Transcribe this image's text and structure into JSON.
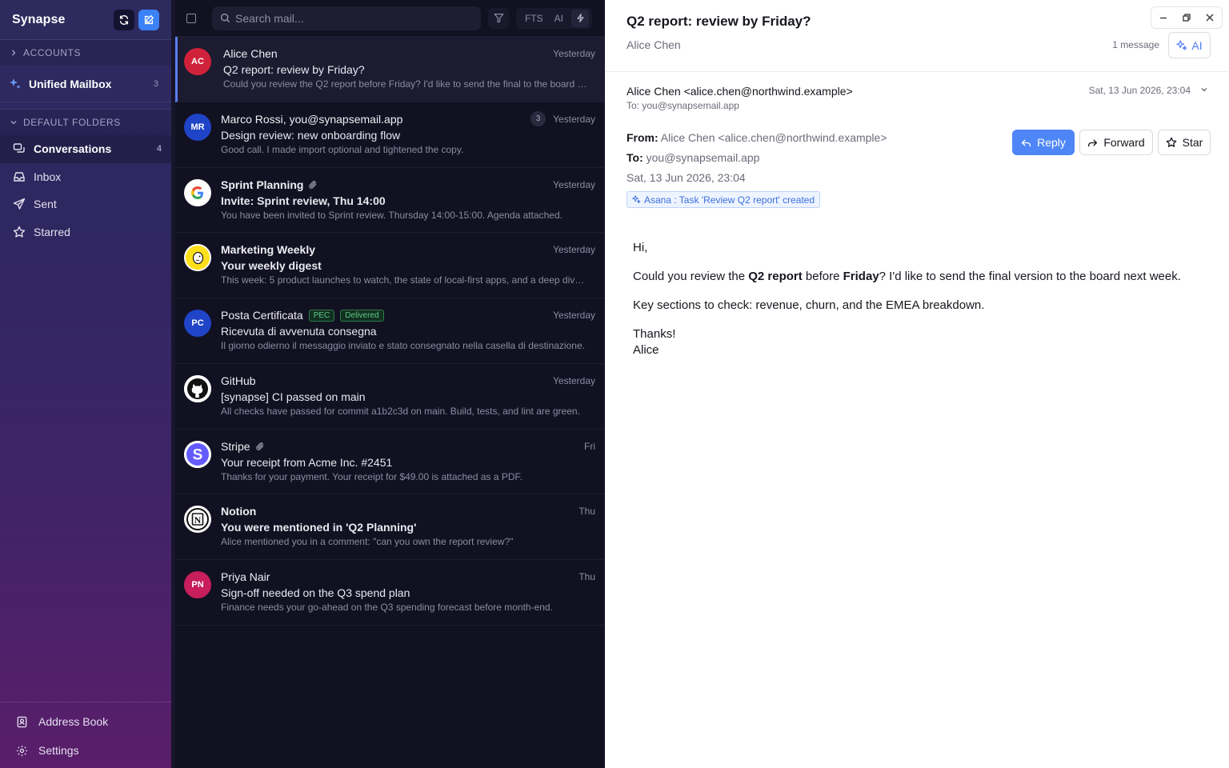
{
  "app": {
    "title": "Synapse"
  },
  "sidebar": {
    "accounts_label": "ACCOUNTS",
    "unified": {
      "label": "Unified Mailbox",
      "count": "3"
    },
    "folders_label": "DEFAULT FOLDERS",
    "folders": [
      {
        "label": "Conversations",
        "count": "4",
        "icon": "conversations-icon"
      },
      {
        "label": "Inbox",
        "count": "",
        "icon": "inbox-icon"
      },
      {
        "label": "Sent",
        "count": "",
        "icon": "send-icon"
      },
      {
        "label": "Starred",
        "count": "",
        "icon": "star-icon"
      }
    ],
    "bottom": [
      {
        "label": "Address Book",
        "icon": "address-book-icon"
      },
      {
        "label": "Settings",
        "icon": "gear-icon"
      }
    ]
  },
  "toolbar": {
    "search_placeholder": "Search mail...",
    "fts_label": "FTS",
    "ai_label": "AI"
  },
  "messages": [
    {
      "initials": "AC",
      "avatar_color": "#d0213b",
      "sender": "Alice Chen",
      "sender_bold": false,
      "time": "Yesterday",
      "subject": "Q2 report: review by Friday?",
      "subject_bold": false,
      "preview": "Could you review the Q2 report before Friday? I'd like to send the final to the board …",
      "selected": true
    },
    {
      "initials": "MR",
      "avatar_color": "#1f44c7",
      "sender": "Marco Rossi, you@synapsemail.app",
      "thread_count": "3",
      "time": "Yesterday",
      "subject": "Design review: new onboarding flow",
      "preview": "Good call. I made import optional and tightened the copy."
    },
    {
      "initials": "G",
      "avatar_type": "google",
      "sender": "Sprint Planning",
      "sender_bold": true,
      "attachment": true,
      "time": "Yesterday",
      "subject": "Invite: Sprint review, Thu 14:00",
      "subject_bold": true,
      "preview": "You have been invited to Sprint review. Thursday 14:00-15:00. Agenda attached."
    },
    {
      "initials": "",
      "avatar_type": "mailchimp",
      "sender": "Marketing Weekly",
      "sender_bold": true,
      "time": "Yesterday",
      "subject": "Your weekly digest",
      "subject_bold": true,
      "preview": "This week: 5 product launches to watch, the state of local-first apps, and a deep div…"
    },
    {
      "initials": "PC",
      "avatar_color": "#1f44c7",
      "sender": "Posta Certificata",
      "tags": [
        "PEC",
        "Delivered"
      ],
      "time": "Yesterday",
      "subject": "Ricevuta di avvenuta consegna",
      "preview": "Il giorno odierno il messaggio inviato e stato consegnato nella casella di destinazione."
    },
    {
      "initials": "",
      "avatar_type": "github",
      "sender": "GitHub",
      "time": "Yesterday",
      "subject": "[synapse] CI passed on main",
      "preview": "All checks have passed for commit a1b2c3d on main. Build, tests, and lint are green."
    },
    {
      "initials": "S",
      "avatar_type": "stripe",
      "sender": "Stripe",
      "attachment": true,
      "time": "Fri",
      "subject": "Your receipt from Acme Inc. #2451",
      "preview": "Thanks for your payment. Your receipt for $49.00 is attached as a PDF."
    },
    {
      "initials": "N",
      "avatar_type": "notion",
      "sender": "Notion",
      "sender_bold": true,
      "time": "Thu",
      "subject": "You were mentioned in 'Q2 Planning'",
      "subject_bold": true,
      "preview": "Alice mentioned you in a comment: \"can you own the report review?\""
    },
    {
      "initials": "PN",
      "avatar_color": "#c81e5b",
      "sender": "Priya Nair",
      "time": "Thu",
      "subject": "Sign-off needed on the Q3 spend plan",
      "preview": "Finance needs your go-ahead on the Q3 spending forecast before month-end."
    }
  ],
  "reader": {
    "thread_title": "Q2 report: review by Friday?",
    "thread_sender": "Alice Chen",
    "message_count": "1 message",
    "ai_label": "AI",
    "from_full": "Alice Chen <alice.chen@northwind.example>",
    "to_short": "To: you@synapsemail.app",
    "date": "Sat, 13 Jun 2026, 23:04",
    "from_label": "From:",
    "from_value": "Alice Chen <alice.chen@northwind.example>",
    "to_label": "To:",
    "to_value": "you@synapsemail.app",
    "date_full": "Sat, 13 Jun 2026, 23:04",
    "chip": "Asana : Task 'Review Q2 report' created",
    "reply_label": "Reply",
    "forward_label": "Forward",
    "star_label": "Star",
    "body": {
      "greeting": "Hi,",
      "p1_a": "Could you review the ",
      "p1_b": "Q2 report",
      "p1_c": " before ",
      "p1_d": "Friday",
      "p1_e": "? I'd like to send the final version to the board next week.",
      "p2": "Key sections to check: revenue, churn, and the EMEA breakdown.",
      "thanks": "Thanks!",
      "signature": "Alice"
    }
  },
  "colors": {
    "accent": "#4f86f7",
    "sidebar_top": "#2d2a5e",
    "sidebar_bottom": "#5a1e6a",
    "list_bg": "#121122"
  }
}
